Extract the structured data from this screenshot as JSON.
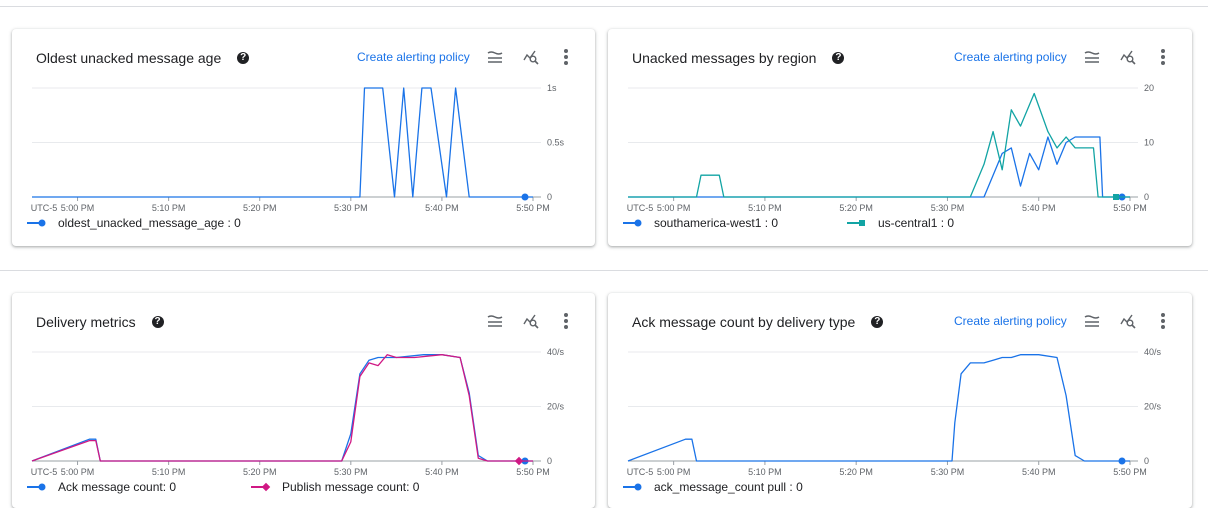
{
  "panels": [
    {
      "title": "Oldest unacked message age",
      "alert_link": "Create alerting policy",
      "y_ticks": [
        "1s",
        "0.5s",
        "0"
      ],
      "x_ticks": [
        "UTC-5",
        "5:00 PM",
        "5:10 PM",
        "5:20 PM",
        "5:30 PM",
        "5:40 PM",
        "5:50 PM"
      ],
      "legend": [
        {
          "label": "oldest_unacked_message_age : 0",
          "color": "#1a73e8",
          "marker": "circle"
        }
      ]
    },
    {
      "title": "Unacked messages by region",
      "alert_link": "Create alerting policy",
      "y_ticks": [
        "20",
        "10",
        "0"
      ],
      "x_ticks": [
        "UTC-5",
        "5:00 PM",
        "5:10 PM",
        "5:20 PM",
        "5:30 PM",
        "5:40 PM",
        "5:50 PM"
      ],
      "legend": [
        {
          "label": "southamerica-west1 : 0",
          "color": "#1a73e8",
          "marker": "circle"
        },
        {
          "label": "us-central1 : 0",
          "color": "#12a4a4",
          "marker": "square"
        }
      ]
    },
    {
      "title": "Delivery metrics",
      "alert_link": "",
      "y_ticks": [
        "40/s",
        "20/s",
        "0"
      ],
      "x_ticks": [
        "UTC-5",
        "5:00 PM",
        "5:10 PM",
        "5:20 PM",
        "5:30 PM",
        "5:40 PM",
        "5:50 PM"
      ],
      "legend": [
        {
          "label": "Ack message count: 0",
          "color": "#1a73e8",
          "marker": "circle"
        },
        {
          "label": "Publish message count: 0",
          "color": "#d01884",
          "marker": "diamond"
        }
      ]
    },
    {
      "title": "Ack message count by delivery type",
      "alert_link": "Create alerting policy",
      "y_ticks": [
        "40/s",
        "20/s",
        "0"
      ],
      "x_ticks": [
        "UTC-5",
        "5:00 PM",
        "5:10 PM",
        "5:20 PM",
        "5:30 PM",
        "5:40 PM",
        "5:50 PM"
      ],
      "legend": [
        {
          "label": "ack_message_count pull : 0",
          "color": "#1a73e8",
          "marker": "circle"
        }
      ]
    }
  ],
  "chart_data": [
    {
      "type": "line",
      "title": "Oldest unacked message age",
      "ylim": [
        0,
        1
      ],
      "x_unit": "minutes after 4:55 PM",
      "series": [
        {
          "name": "oldest_unacked_message_age",
          "color": "#1a73e8",
          "x": [
            0,
            36,
            36.5,
            38.5,
            39.8,
            40.8,
            41.8,
            42.8,
            43.8,
            45.5,
            46.5,
            48,
            48.8,
            50,
            55
          ],
          "y": [
            0,
            0,
            1,
            1,
            0,
            1,
            0,
            1,
            1,
            0,
            1,
            0,
            0,
            0,
            0
          ]
        }
      ]
    },
    {
      "type": "line",
      "title": "Unacked messages by region",
      "ylim": [
        0,
        20
      ],
      "series": [
        {
          "name": "southamerica-west1",
          "color": "#1a73e8",
          "x": [
            0,
            39,
            40,
            41,
            42,
            43,
            44,
            45,
            46,
            47,
            48,
            49,
            50,
            51,
            51.7,
            52,
            55
          ],
          "y": [
            0,
            0,
            4,
            8,
            9,
            2,
            8,
            5,
            11,
            6,
            10,
            11,
            11,
            11,
            11,
            0,
            0
          ]
        },
        {
          "name": "us-central1",
          "color": "#12a4a4",
          "x": [
            0,
            7.5,
            8,
            10,
            10.5,
            37.5,
            39,
            40,
            41,
            42,
            43,
            44.5,
            46,
            47,
            48,
            49,
            50,
            51,
            51.5,
            55
          ],
          "y": [
            0,
            0,
            4,
            4,
            0,
            0,
            6,
            12,
            5,
            16,
            13,
            19,
            12,
            9,
            11,
            9,
            9,
            9,
            0,
            0
          ]
        }
      ]
    },
    {
      "type": "line",
      "title": "Delivery metrics",
      "ylim": [
        0,
        40
      ],
      "series": [
        {
          "name": "Ack message count",
          "color": "#1a73e8",
          "x": [
            0,
            6.3,
            7,
            7.5,
            26,
            30,
            34,
            35,
            36,
            37,
            38,
            40,
            43,
            45,
            47,
            48,
            49,
            50,
            55
          ],
          "y": [
            0,
            8,
            8,
            0,
            0,
            0,
            0,
            10,
            32,
            37,
            38,
            38,
            39,
            39,
            38,
            25,
            2,
            0,
            0
          ]
        },
        {
          "name": "Publish message count",
          "color": "#d01884",
          "x": [
            0,
            6.3,
            7,
            7.5,
            26,
            30,
            34,
            35,
            36,
            37,
            38,
            39,
            40,
            42,
            45,
            47,
            48,
            49,
            50,
            55
          ],
          "y": [
            0,
            7.5,
            7.5,
            0,
            0,
            0,
            0,
            7,
            31,
            36,
            35,
            39,
            38,
            38,
            39,
            38,
            24,
            1,
            0,
            0
          ]
        }
      ]
    },
    {
      "type": "line",
      "title": "Ack message count by delivery type",
      "ylim": [
        0,
        40
      ],
      "series": [
        {
          "name": "ack_message_count pull",
          "color": "#1a73e8",
          "x": [
            0,
            6.3,
            7,
            7.5,
            35.5,
            35.8,
            36.5,
            37.5,
            39,
            40,
            41,
            42,
            43,
            45,
            47,
            48,
            49,
            50,
            55
          ],
          "y": [
            0,
            8,
            8,
            0,
            0,
            14,
            32,
            36,
            36,
            37,
            38,
            38,
            39,
            39,
            38,
            24,
            2,
            0,
            0
          ]
        }
      ]
    }
  ]
}
